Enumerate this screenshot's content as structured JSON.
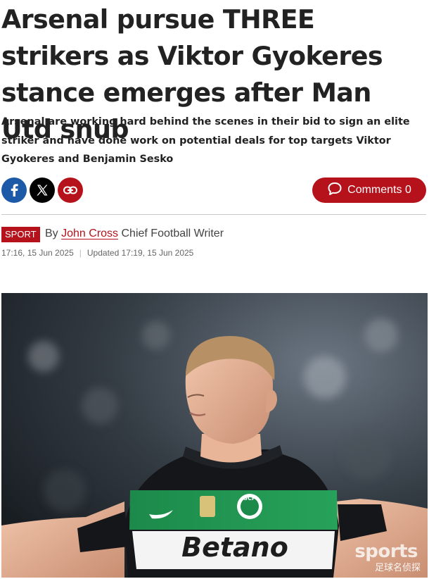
{
  "article": {
    "headline": "Arsenal pursue THREE strikers as Viktor Gyokeres stance emerges after Man Utd snub",
    "standfirst": "Arsenal are working hard behind the scenes in their bid to sign an elite striker and have done work on potential deals for top targets Viktor Gyokeres and Benjamin Sesko",
    "section_badge": "SPORT",
    "by_prefix": "By",
    "author": "John Cross",
    "author_role": "Chief Football Writer",
    "published": "17:16, 15 Jun 2025",
    "updated": "Updated 17:19, 15 Jun 2025"
  },
  "share": {
    "buttons": [
      {
        "icon": "facebook-icon",
        "color": "#1c5aa8"
      },
      {
        "icon": "x-icon",
        "color": "#000000"
      },
      {
        "icon": "link-icon",
        "color": "#b5121b"
      }
    ]
  },
  "comments": {
    "label": "Comments 0",
    "icon": "speech-bubble-icon",
    "color": "#b5121b"
  },
  "hero_image": {
    "shirt_sponsor": "Betano",
    "crest_text": "SCP",
    "watermark": "sports",
    "watermark_sub": "足球名侦探"
  },
  "colors": {
    "accent": "#b5121b",
    "text": "#222222",
    "meta": "#666666"
  }
}
